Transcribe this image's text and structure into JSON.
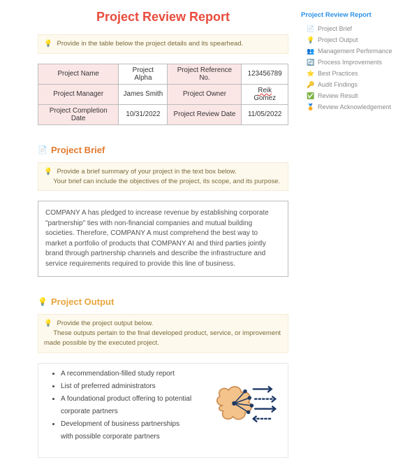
{
  "title": "Project Review Report",
  "hint_details": "Provide in the table below the project details and its spearhead.",
  "details": {
    "r1c1l": "Project Name",
    "r1c1v": "Project Alpha",
    "r1c2l": "Project Reference No.",
    "r1c2v": "123456789",
    "r2c1l": "Project Manager",
    "r2c1v": "James Smith",
    "r2c2l": "Project Owner",
    "r2c2v_pre": "Reik",
    "r2c2v_post": " Gomez",
    "r3c1l": "Project Completion Date",
    "r3c1v": "10/31/2022",
    "r3c2l": "Project Review Date",
    "r3c2v": "11/05/2022"
  },
  "brief": {
    "heading": "Project Brief",
    "hint_l1": "Provide a brief summary of your project in the text box below.",
    "hint_l2": "Your brief can include the objectives of the project, its scope, and its purpose.",
    "body": "COMPANY A has pledged to increase revenue by establishing corporate \"partnership\" ties with non-financial companies and mutual building societies. Therefore, COMPANY A must comprehend the best way to market a portfolio of products that COMPANY AI and third parties jointly brand through partnership channels and describe the infrastructure and service requirements required to provide this line of business."
  },
  "output": {
    "heading": "Project Output",
    "hint_l1": "Provide the project output below.",
    "hint_l2": "These outputs pertain to the final developed product, service, or improvement made possible by the executed project.",
    "items": [
      "A recommendation-filled study report",
      "List of preferred administrators",
      "A foundational product offering to potential corporate partners",
      "Development of business partnerships with possible corporate partners"
    ]
  },
  "toc": {
    "title": "Project Review Report",
    "items": [
      {
        "icon": "📄",
        "label": "Project Brief"
      },
      {
        "icon": "💡",
        "label": "Project Output"
      },
      {
        "icon": "👥",
        "label": "Management Performance"
      },
      {
        "icon": "🔄",
        "label": "Process Improvements"
      },
      {
        "icon": "⭐",
        "label": "Best Practices"
      },
      {
        "icon": "🔑",
        "label": "Audit Findings"
      },
      {
        "icon": "✅",
        "label": "Review Result"
      },
      {
        "icon": "🏅",
        "label": "Review Acknowledgement"
      }
    ]
  }
}
